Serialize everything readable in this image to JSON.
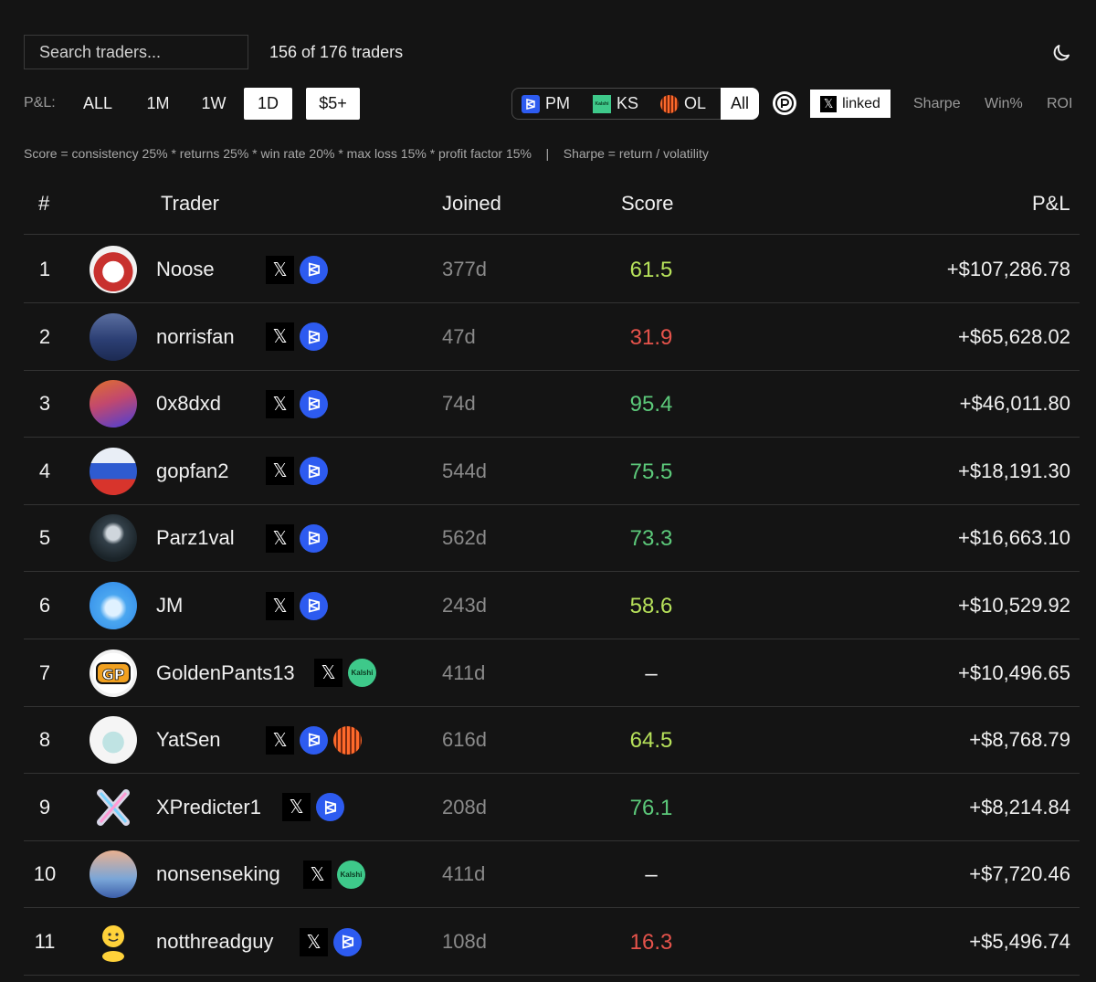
{
  "search": {
    "placeholder": "Search traders..."
  },
  "trader_count": "156 of 176 traders",
  "controls": {
    "pl_label": "P&L:",
    "periods": [
      "ALL",
      "1M",
      "1W",
      "1D"
    ],
    "active_period": "1D",
    "min_filter": "$5+",
    "platforms": [
      "PM",
      "KS",
      "OL"
    ],
    "platforms_all": "All",
    "linked_label": "linked",
    "sort_options": [
      "Sharpe",
      "Win%",
      "ROI"
    ]
  },
  "formula": "Score = consistency 25% * returns 25% * win rate 20% * max loss 15% * profit factor 15%    |    Sharpe = return / volatility",
  "table": {
    "headers": {
      "rank": "#",
      "trader": "Trader",
      "joined": "Joined",
      "score": "Score",
      "pnl": "P&L"
    },
    "rows": [
      {
        "rank": "1",
        "name": "Noose",
        "badges": [
          "x",
          "pm"
        ],
        "joined": "377d",
        "score": "61.5",
        "score_color": "#b6e15a",
        "pnl": "+$107,286.78"
      },
      {
        "rank": "2",
        "name": "norrisfan",
        "badges": [
          "x",
          "pm"
        ],
        "joined": "47d",
        "score": "31.9",
        "score_color": "#e5534b",
        "pnl": "+$65,628.02"
      },
      {
        "rank": "3",
        "name": "0x8dxd",
        "badges": [
          "x",
          "pm"
        ],
        "joined": "74d",
        "score": "95.4",
        "score_color": "#5cc97a",
        "pnl": "+$46,011.80"
      },
      {
        "rank": "4",
        "name": "gopfan2",
        "badges": [
          "x",
          "pm"
        ],
        "joined": "544d",
        "score": "75.5",
        "score_color": "#5cc97a",
        "pnl": "+$18,191.30"
      },
      {
        "rank": "5",
        "name": "Parz1val",
        "badges": [
          "x",
          "pm"
        ],
        "joined": "562d",
        "score": "73.3",
        "score_color": "#5cc97a",
        "pnl": "+$16,663.10"
      },
      {
        "rank": "6",
        "name": "JM",
        "badges": [
          "x",
          "pm"
        ],
        "joined": "243d",
        "score": "58.6",
        "score_color": "#b6e15a",
        "pnl": "+$10,529.92"
      },
      {
        "rank": "7",
        "name": "GoldenPants13",
        "badges": [
          "x",
          "ks"
        ],
        "joined": "411d",
        "score": "–",
        "score_color": "#f0f0f0",
        "pnl": "+$10,496.65"
      },
      {
        "rank": "8",
        "name": "YatSen",
        "badges": [
          "x",
          "pm",
          "ol"
        ],
        "joined": "616d",
        "score": "64.5",
        "score_color": "#b6e15a",
        "pnl": "+$8,768.79"
      },
      {
        "rank": "9",
        "name": "XPredicter1",
        "badges": [
          "x",
          "pm"
        ],
        "joined": "208d",
        "score": "76.1",
        "score_color": "#5cc97a",
        "pnl": "+$8,214.84"
      },
      {
        "rank": "10",
        "name": "nonsenseking",
        "badges": [
          "x",
          "ks"
        ],
        "joined": "411d",
        "score": "–",
        "score_color": "#f0f0f0",
        "pnl": "+$7,720.46"
      },
      {
        "rank": "11",
        "name": "notthreadguy",
        "badges": [
          "x",
          "pm"
        ],
        "joined": "108d",
        "score": "16.3",
        "score_color": "#e5534b",
        "pnl": "+$5,496.74"
      }
    ]
  },
  "badge_icons": {
    "x": "x-logo-icon",
    "pm": "polymarket-icon",
    "ks": "kalshi-icon",
    "ol": "ol-icon"
  },
  "kalshi_text": "Kalshi"
}
